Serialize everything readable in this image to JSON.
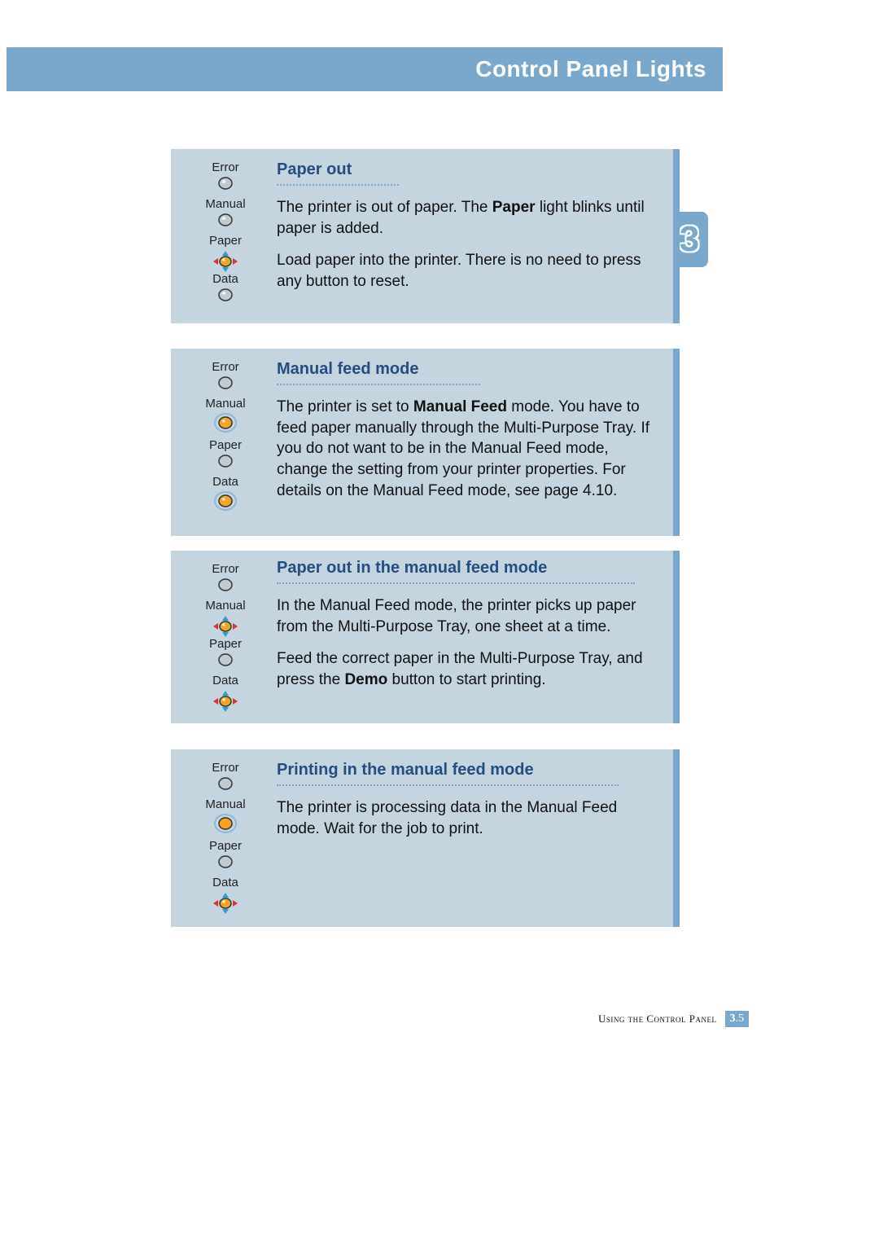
{
  "header": {
    "title": "Control Panel Lights"
  },
  "chapter": {
    "number": "3"
  },
  "leds": {
    "error": "Error",
    "manual": "Manual",
    "paper": "Paper",
    "data": "Data"
  },
  "panels": {
    "paperOut": {
      "title": "Paper out",
      "p1a": "The printer is out of paper. The ",
      "p1b": "Paper",
      "p1c": " light blinks until paper is added.",
      "p2": "Load paper into the printer. There is no need to press any button to reset."
    },
    "manualFeed": {
      "title": "Manual feed mode",
      "p1a": "The printer is set to ",
      "p1b": "Manual Feed",
      "p1c": " mode. You have to feed paper manually through the Multi-Purpose Tray. If you do not want to be in the Manual Feed mode, change the setting from your printer properties. For details on the Manual Feed mode, see page 4.10."
    },
    "paperOutManual": {
      "title": "Paper out in the manual feed mode",
      "p1": "In the Manual Feed mode, the printer picks up paper from the Multi-Purpose Tray, one sheet at a time.",
      "p2a": "Feed the correct paper in the Multi-Purpose Tray, and press the ",
      "p2b": "Demo",
      "p2c": " button to start printing."
    },
    "printingManual": {
      "title": "Printing in the manual feed mode",
      "p1": "The printer is processing data in the Manual Feed mode. Wait for the job to print."
    }
  },
  "footer": {
    "text": "Using the Control Panel",
    "page_major": "3",
    "page_minor": ".5"
  }
}
